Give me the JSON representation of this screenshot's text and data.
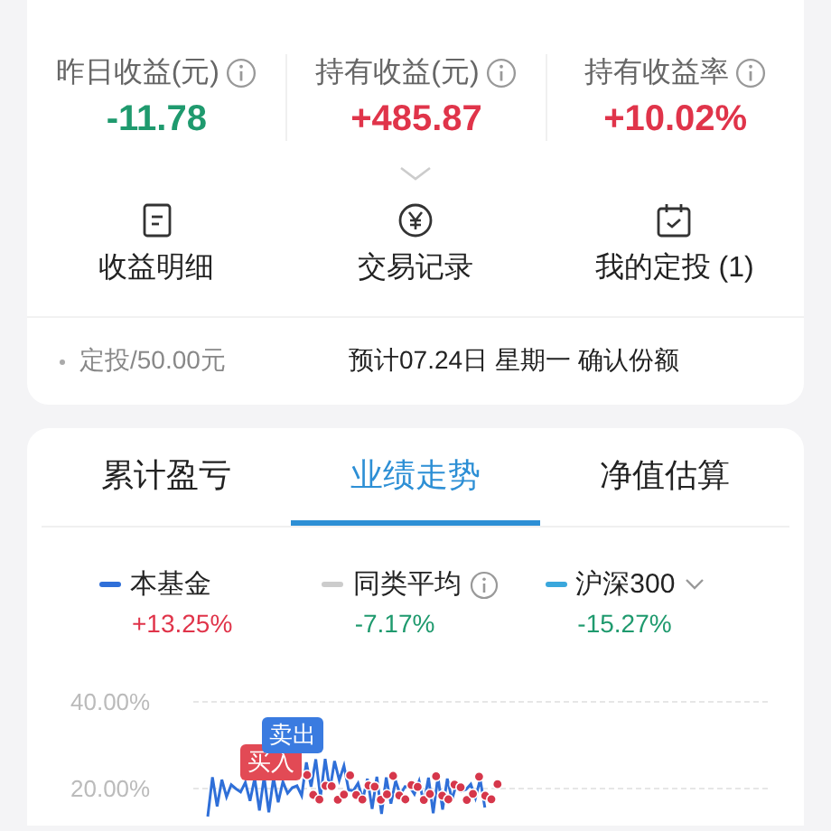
{
  "stats": [
    {
      "label": "昨日收益(元)",
      "value": "-11.78",
      "color": "#1f9a6e",
      "info": true
    },
    {
      "label": "持有收益(元)",
      "value": "+485.87",
      "color": "#e0344a",
      "info": true
    },
    {
      "label": "持有收益率",
      "value": "+10.02%",
      "color": "#e0344a",
      "info": true
    }
  ],
  "actions": [
    {
      "label": "收益明细"
    },
    {
      "label": "交易记录"
    },
    {
      "label": "我的定投 (1)"
    }
  ],
  "plan": {
    "amount": "定投/50.00元",
    "note": "预计07.24日 星期一 确认份额"
  },
  "tabs": [
    {
      "label": "累计盈亏",
      "selected": false
    },
    {
      "label": "业绩走势",
      "selected": true
    },
    {
      "label": "净值估算",
      "selected": false
    }
  ],
  "legend": [
    {
      "name": "本基金",
      "value": {
        "text": "+13.25%",
        "color": "#e0344a"
      },
      "color": "#2f6fd8",
      "info": false,
      "dropdown": false
    },
    {
      "name": "同类平均",
      "value": {
        "text": "-7.17%",
        "color": "#1f9a6e"
      },
      "color": "#cccccc",
      "info": true,
      "dropdown": false
    },
    {
      "name": "沪深300",
      "value": {
        "text": "-15.27%",
        "color": "#1f9a6e"
      },
      "color": "#3aa7dc",
      "info": false,
      "dropdown": true
    }
  ],
  "chart": {
    "y_axis_labels": [
      "40.00%",
      "20.00%"
    ],
    "markers": [
      {
        "label": "买入",
        "kind": "buy"
      },
      {
        "label": "卖出",
        "kind": "sell"
      }
    ]
  }
}
